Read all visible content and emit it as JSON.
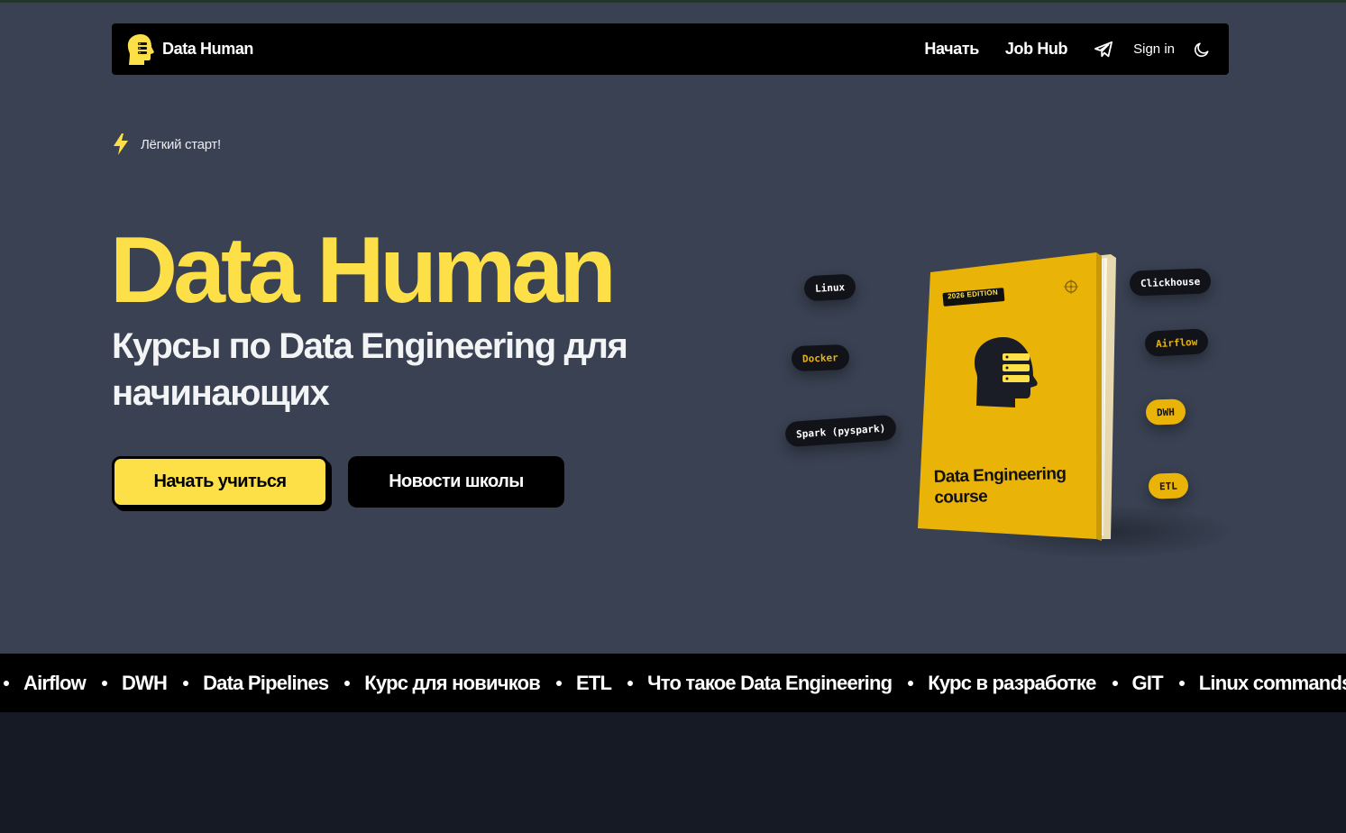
{
  "nav": {
    "brand": "Data Human",
    "links": [
      "Начать",
      "Job Hub"
    ],
    "signin": "Sign in",
    "icons": {
      "logo": "head-server-icon",
      "telegram": "telegram-icon",
      "theme": "moon-icon"
    }
  },
  "hero": {
    "badge": "Лёгкий старт!",
    "badge_icon": "lightning-icon",
    "title": "Data Human",
    "subtitle": "Курсы по Data Engineering для начинающих",
    "primary_button": "Начать учиться",
    "secondary_button": "Новости школы"
  },
  "book": {
    "edition": "2026 EDITION",
    "title_line1": "Data Engineering",
    "title_line2": "course"
  },
  "tags": {
    "linux": "Linux",
    "docker": "Docker",
    "spark": "Spark (pyspark)",
    "clickhouse": "Clickhouse",
    "airflow": "Airflow",
    "dwh": "DWH",
    "etl": "ETL"
  },
  "ticker": [
    "Airflow",
    "DWH",
    "Data Pipelines",
    "Курс для новичков",
    "ETL",
    "Что такое Data Engineering",
    "Курс в разработке",
    "GIT",
    "Linux commands"
  ],
  "colors": {
    "accent": "#fde047",
    "hero_bg": "#394152",
    "page_bg": "#161a24",
    "nav_bg": "#000000"
  }
}
